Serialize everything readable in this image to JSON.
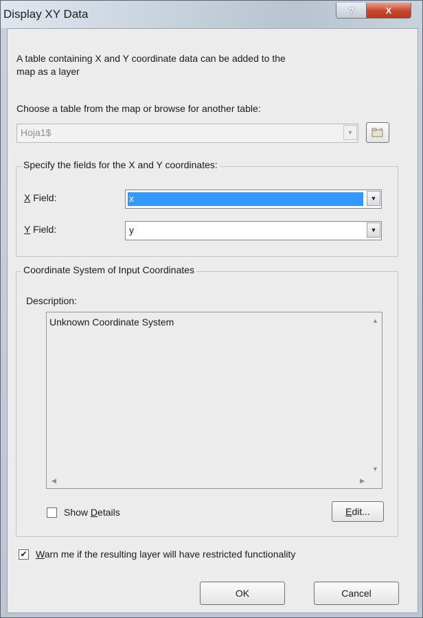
{
  "window": {
    "title": "Display XY Data",
    "help_label": "?",
    "close_label": "X"
  },
  "intro_text_line1": "A table containing X and Y coordinate data can be added to the",
  "intro_text_line2": "map as a layer",
  "choose_label": "Choose a table from the map or browse for another table:",
  "table_select": {
    "value": "Hoja1$",
    "disabled": true
  },
  "fields_group": {
    "label": "Specify the fields for the X and Y coordinates:",
    "x_label_key": "X",
    "x_label_rest": " Field:",
    "x_value": "x",
    "y_label_key": "Y",
    "y_label_rest": " Field:",
    "y_value": "y"
  },
  "coord_group": {
    "label": "Coordinate System of Input Coordinates",
    "description_label": "Description:",
    "description_text": "Unknown Coordinate System",
    "show_details_pre": "Show ",
    "show_details_key": "D",
    "show_details_post": "etails",
    "show_details_checked": false,
    "edit_key": "E",
    "edit_rest": "dit..."
  },
  "warn": {
    "checked": true,
    "key": "W",
    "rest": "arn me if the resulting layer will have restricted functionality"
  },
  "buttons": {
    "ok": "OK",
    "cancel": "Cancel"
  },
  "colors": {
    "selection": "#3399ff",
    "close": "#c8442b"
  }
}
